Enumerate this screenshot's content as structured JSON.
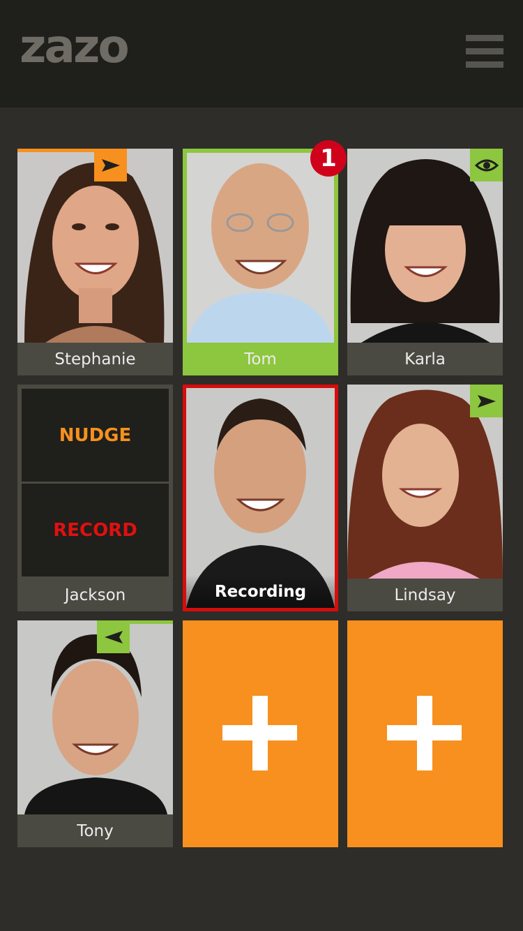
{
  "app": {
    "logo": "zazo"
  },
  "header": {
    "menu_icon": "hamburger-menu-icon"
  },
  "tiles": [
    {
      "name": "Stephanie",
      "status_icon": "send-arrow-icon",
      "status_color": "#f7901e"
    },
    {
      "name": "Tom",
      "unread_count": "1",
      "highlight_color": "#8dc63f"
    },
    {
      "name": "Karla",
      "status_icon": "eye-icon",
      "status_color": "#8dc63f"
    },
    {
      "name": "Jackson",
      "actions": {
        "nudge": "NUDGE",
        "record": "RECORD"
      }
    },
    {
      "name": "Recording",
      "border_color": "#d80c0c"
    },
    {
      "name": "Lindsay",
      "status_icon": "send-arrow-icon",
      "status_color": "#8dc63f"
    },
    {
      "name": "Tony",
      "status_icon": "received-arrow-icon",
      "status_color": "#8dc63f"
    }
  ],
  "add_tiles": [
    {
      "icon": "plus-icon",
      "color": "#f7901e"
    },
    {
      "icon": "plus-icon",
      "color": "#f7901e"
    }
  ]
}
